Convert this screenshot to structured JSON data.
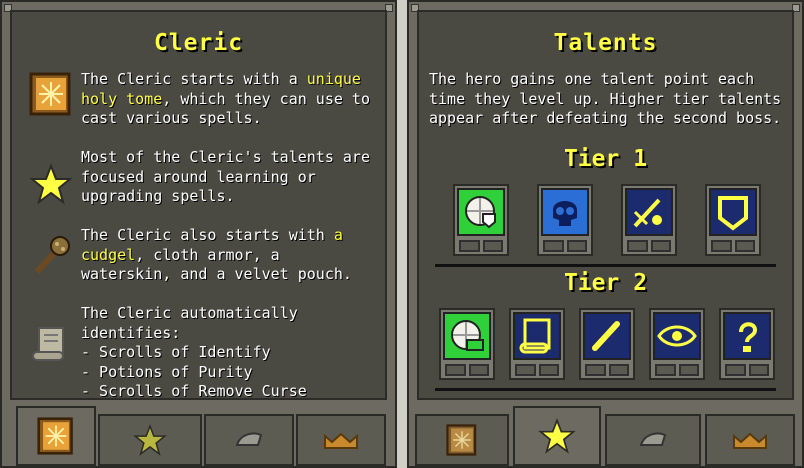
{
  "left_panel": {
    "title": "Cleric",
    "entries": [
      {
        "icon": "holy-tome-icon",
        "text_a": "The Cleric starts with a ",
        "highlight": "unique holy tome",
        "text_b": ", which they can use to cast various spells."
      },
      {
        "icon": "star-icon",
        "text": "Most of the Cleric's talents are focused around learning or upgrading spells."
      },
      {
        "icon": "cudgel-icon",
        "text_a": "The Cleric also starts with ",
        "highlight": "a cudgel",
        "text_b": ", cloth armor, a waterskin, and a velvet pouch."
      },
      {
        "icon": "scroll-icon",
        "lines": [
          "The Cleric automatically identifies:",
          "- Scrolls of Identify",
          "- Potions of Purity",
          "- Scrolls of Remove Curse"
        ]
      }
    ],
    "tabs": [
      "holy-tome-icon",
      "star-icon",
      "armor-icon",
      "crown-icon"
    ]
  },
  "right_panel": {
    "title": "Talents",
    "description": "The hero gains one talent point each time they level up. Higher tier talents appear after defeating the second boss.",
    "tier1": {
      "label": "Tier 1",
      "talents": [
        {
          "icon": "clock-shield-talent-icon",
          "color": "#2fd03a"
        },
        {
          "icon": "skull-talent-icon",
          "color": "#2b6fd6"
        },
        {
          "icon": "wand-talent-icon",
          "color": "#1c2a6e"
        },
        {
          "icon": "shield-talent-icon",
          "color": "#1c2a6e"
        }
      ]
    },
    "tier2": {
      "label": "Tier 2",
      "talents": [
        {
          "icon": "clock-scroll-talent-icon",
          "color": "#2fd03a"
        },
        {
          "icon": "scroll-talent-icon",
          "color": "#1c2a6e"
        },
        {
          "icon": "wand-talent-icon",
          "color": "#1c2a6e"
        },
        {
          "icon": "eye-talent-icon",
          "color": "#1c2a6e"
        },
        {
          "icon": "lock-talent-icon",
          "color": "#1c2a6e"
        }
      ]
    },
    "tabs": [
      "holy-tome-icon",
      "star-icon",
      "armor-icon",
      "crown-icon"
    ]
  }
}
